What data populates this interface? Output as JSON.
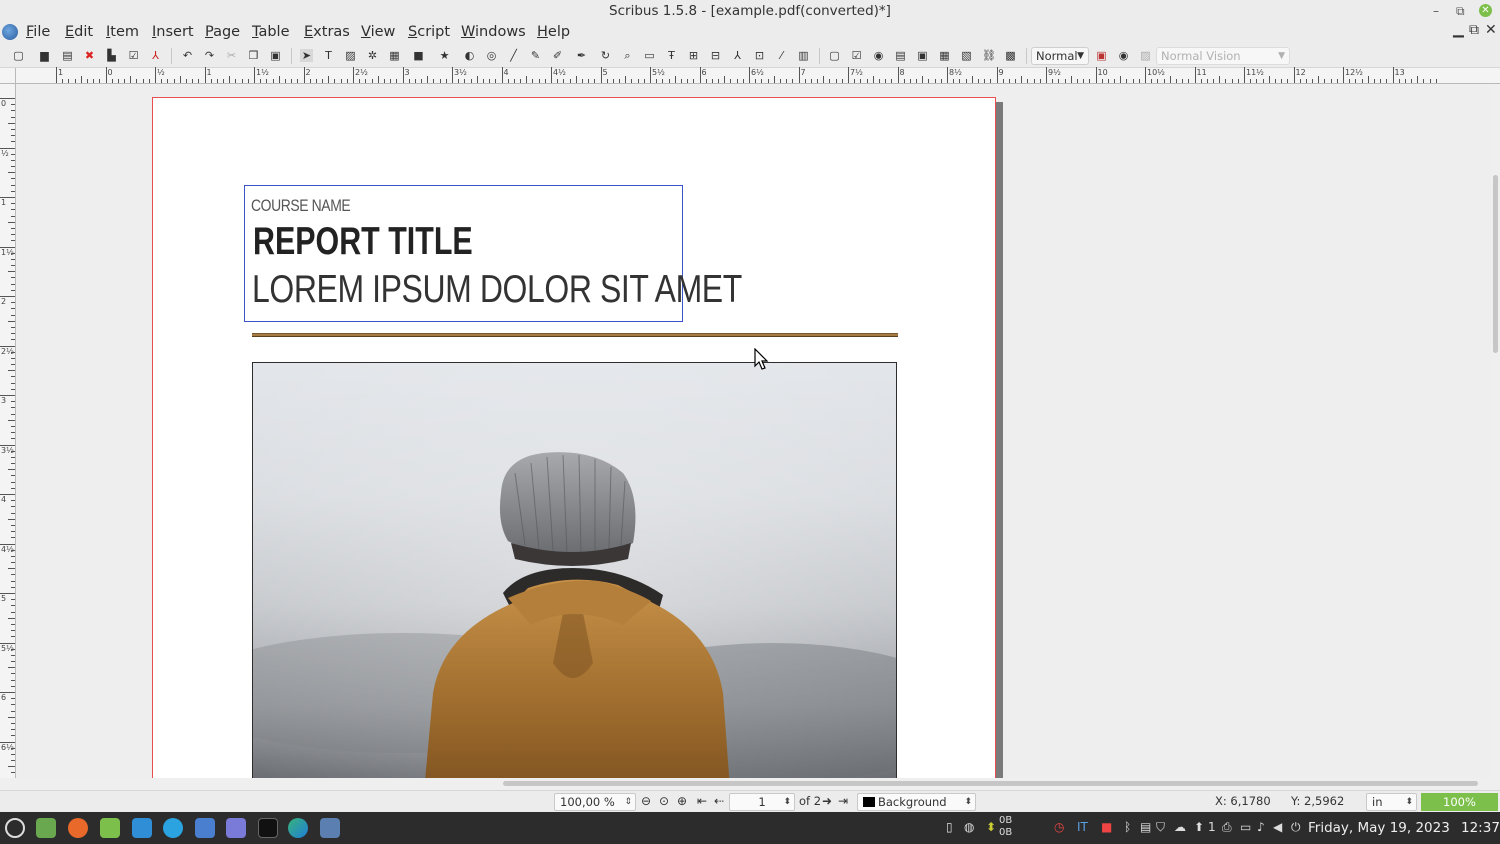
{
  "window": {
    "title": "Scribus 1.5.8 - [example.pdf(converted)*]",
    "minimize_glyph": "–",
    "maximize_glyph": "⧉",
    "close_glyph": "✕"
  },
  "menubar": {
    "items": [
      {
        "label": "File",
        "hotkey": "F",
        "rest": "ile"
      },
      {
        "label": "Edit",
        "hotkey": "E",
        "rest": "dit"
      },
      {
        "label": "Item",
        "hotkey": "I",
        "rest": "tem"
      },
      {
        "label": "Insert",
        "hotkey": "I",
        "rest": "nsert"
      },
      {
        "label": "Page",
        "hotkey": "P",
        "rest": "age"
      },
      {
        "label": "Table",
        "hotkey": "T",
        "rest": "able"
      },
      {
        "label": "Extras",
        "hotkey": "E",
        "rest": "xtras"
      },
      {
        "label": "View",
        "hotkey": "V",
        "rest": "iew"
      },
      {
        "label": "Script",
        "hotkey": "S",
        "rest": "cript"
      },
      {
        "label": "Windows",
        "hotkey": "W",
        "rest": "indows"
      },
      {
        "label": "Help",
        "hotkey": "H",
        "rest": "elp"
      }
    ],
    "mdi_min": "▁",
    "mdi_restore": "⧉",
    "mdi_close": "✕"
  },
  "toolbar": {
    "render_mode": "Normal",
    "vision_mode": "Normal Vision"
  },
  "ruler": {
    "h_labels": [
      "1",
      "0",
      "½",
      "1",
      "1½",
      "2",
      "2½",
      "3",
      "3½",
      "4",
      "4½",
      "5",
      "5½",
      "6",
      "6½",
      "7",
      "7½",
      "8",
      "8½",
      "9",
      "9½",
      "10",
      "10½",
      "11",
      "11½",
      "12",
      "12½",
      "13"
    ],
    "v_labels": [
      "0",
      "½",
      "1",
      "1½",
      "2",
      "2½",
      "3",
      "3½",
      "4",
      "4½",
      "5",
      "5½",
      "6",
      "6½"
    ]
  },
  "document": {
    "course_name": "COURSE NAME",
    "report_title": "REPORT TITLE",
    "subtitle": "LOREM IPSUM DOLOR SIT AMET"
  },
  "statusbar": {
    "zoom_value": "100,00 %",
    "page_number": "1",
    "page_of": "of 2",
    "layer": "Background",
    "x_coord": "X: 6,1780",
    "y_coord": "Y: 2,5962",
    "unit": "in",
    "zoom_badge": "100%"
  },
  "taskbar": {
    "keyboard_layout": "IT",
    "workspace": "1",
    "net_up": "0B",
    "net_down": "0B",
    "date": "Friday, May 19, 2023",
    "time": "12:37"
  },
  "colors": {
    "accent_green": "#7cbf4a",
    "page_border": "#e85050",
    "frame_selection": "#3a55c8",
    "rule_line": "#a57b43"
  }
}
